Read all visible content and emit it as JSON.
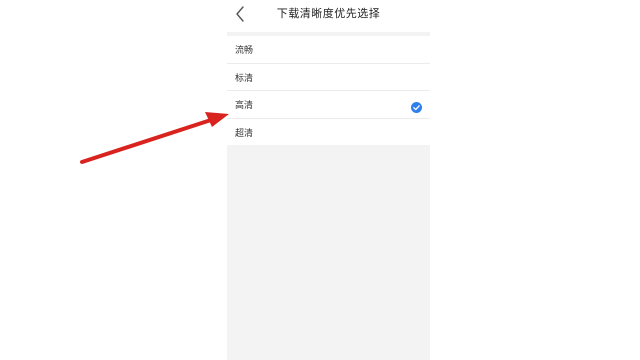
{
  "header": {
    "title": "下载清晰度优先选择",
    "back_icon": "chevron-left-icon"
  },
  "options": [
    {
      "label": "流畅",
      "selected": false
    },
    {
      "label": "标清",
      "selected": false
    },
    {
      "label": "高清",
      "selected": true
    },
    {
      "label": "超清",
      "selected": false
    }
  ],
  "colors": {
    "accent": "#2f80ed",
    "annotation_arrow": "#d9231f",
    "panel_background": "#f3f3f3"
  },
  "annotation": {
    "icon": "red-arrow-icon",
    "points_to": "高清"
  }
}
